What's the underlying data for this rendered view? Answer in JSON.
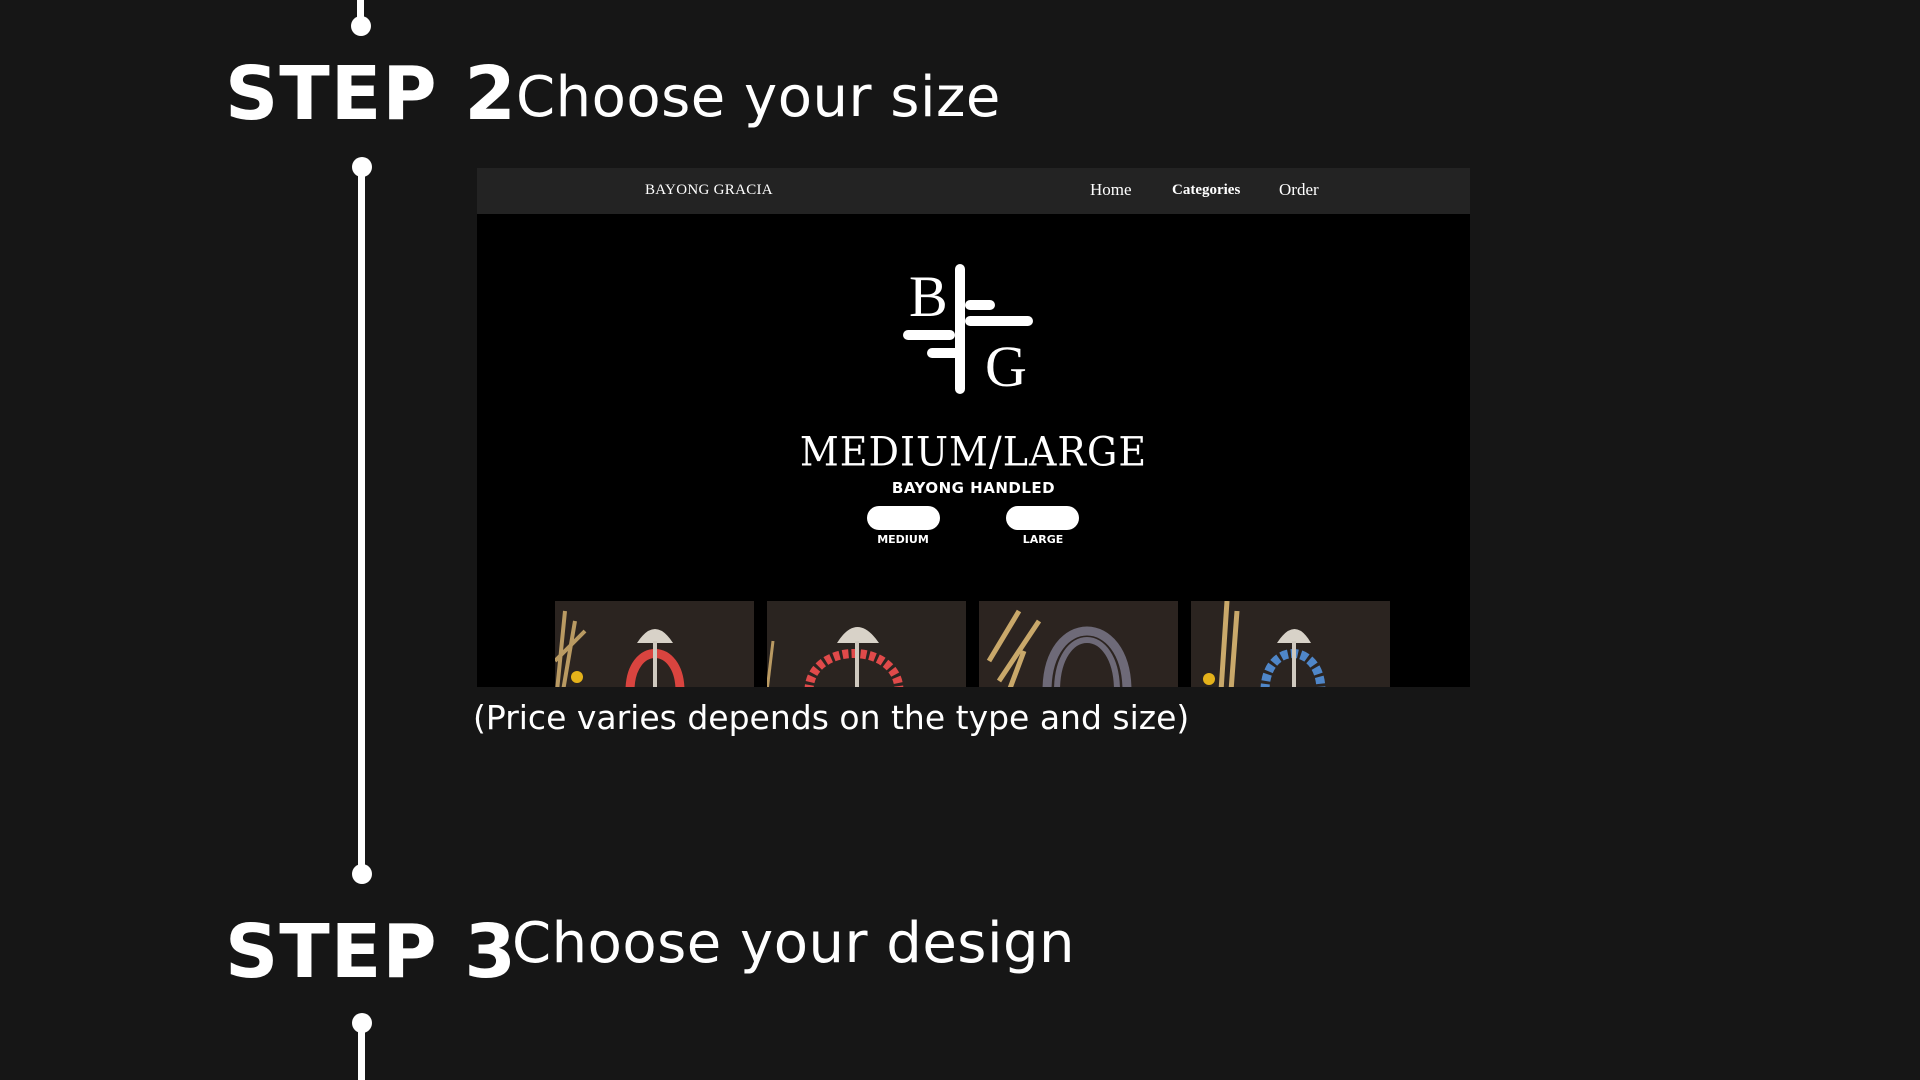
{
  "steps": [
    {
      "number": "STEP 2",
      "title": "Choose your size"
    },
    {
      "number": "STEP 3",
      "title": "Choose your design"
    }
  ],
  "caption": "(Price varies depends on the type and size)",
  "site": {
    "brand": "BAYONG GRACIA",
    "nav": [
      {
        "label": "Home"
      },
      {
        "label": "Categories"
      },
      {
        "label": "Order"
      }
    ],
    "logo_letters": [
      "B",
      "G"
    ],
    "hero_title": "MEDIUM/LARGE",
    "hero_subtitle": "BAYONG HANDLED",
    "size_options": [
      {
        "label": "MEDIUM"
      },
      {
        "label": "LARGE"
      }
    ],
    "thumbnails": [
      {
        "handle_color": "#d9443f"
      },
      {
        "handle_color": "#e04a4a"
      },
      {
        "handle_color": "#6e6a78"
      },
      {
        "handle_color": "#4f86c8"
      }
    ]
  }
}
